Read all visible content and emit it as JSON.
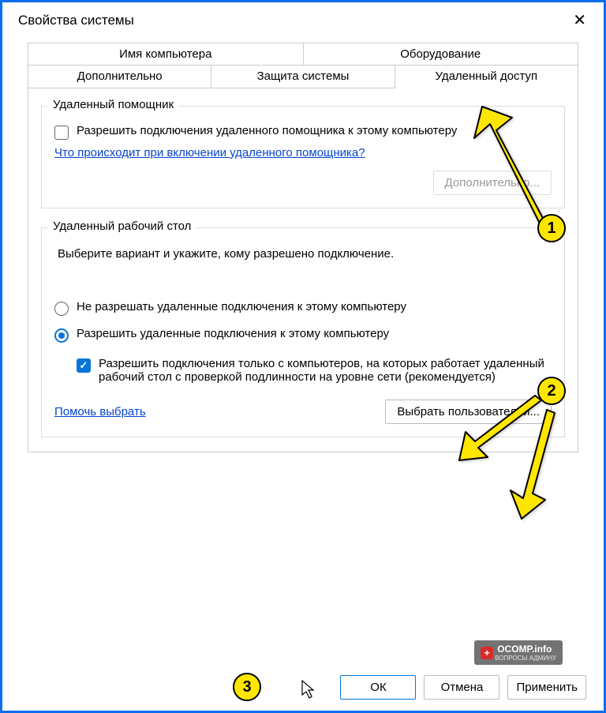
{
  "window": {
    "title": "Свойства системы"
  },
  "tabs": {
    "row1": [
      "Имя компьютера",
      "Оборудование"
    ],
    "row2": [
      "Дополнительно",
      "Защита системы",
      "Удаленный доступ"
    ]
  },
  "group_assistant": {
    "title": "Удаленный помощник",
    "checkbox_label": "Разрешить подключения удаленного помощника к этому компьютеру",
    "link": "Что происходит при включении удаленного помощника?",
    "advanced_btn": "Дополнительно..."
  },
  "group_desktop": {
    "title": "Удаленный рабочий стол",
    "desc": "Выберите вариант и укажите, кому разрешено подключение.",
    "radio_deny": "Не разрешать удаленные подключения к этому компьютеру",
    "radio_allow": "Разрешить удаленные подключения к этому компьютеру",
    "nla_checkbox": "Разрешить подключения только с компьютеров, на которых работает удаленный рабочий стол с проверкой подлинности на уровне сети (рекомендуется)",
    "help_link": "Помочь выбрать",
    "select_users_btn": "Выбрать пользователей..."
  },
  "buttons": {
    "ok": "ОК",
    "cancel": "Отмена",
    "apply": "Применить"
  },
  "annotations": {
    "badge1": "1",
    "badge2": "2",
    "badge3": "3"
  },
  "watermark": {
    "text": "OCOMP.info",
    "sub": "ВОПРОСЫ АДМИНУ"
  }
}
